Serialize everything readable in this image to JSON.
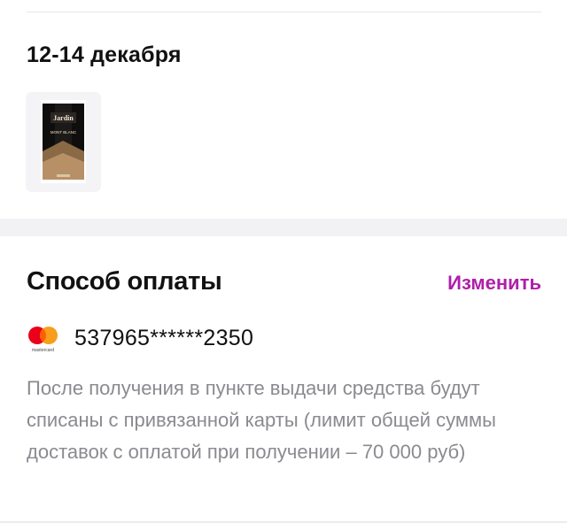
{
  "delivery": {
    "date_range": "12-14 декабря",
    "product": {
      "brand_text": "Jardin",
      "variant_text": "MONT BLANC"
    }
  },
  "payment": {
    "title": "Способ оплаты",
    "change_label": "Изменить",
    "card_brand": "mastercard",
    "card_number": "537965******2350",
    "note": "После получения в пункте выдачи средства будут списаны с привязанной карты (лимит общей суммы доставок с оплатой при получении – 70 000 руб)"
  },
  "colors": {
    "accent": "#b01eaa",
    "muted_text": "#8a8a90",
    "separator": "#f2f2f4"
  }
}
